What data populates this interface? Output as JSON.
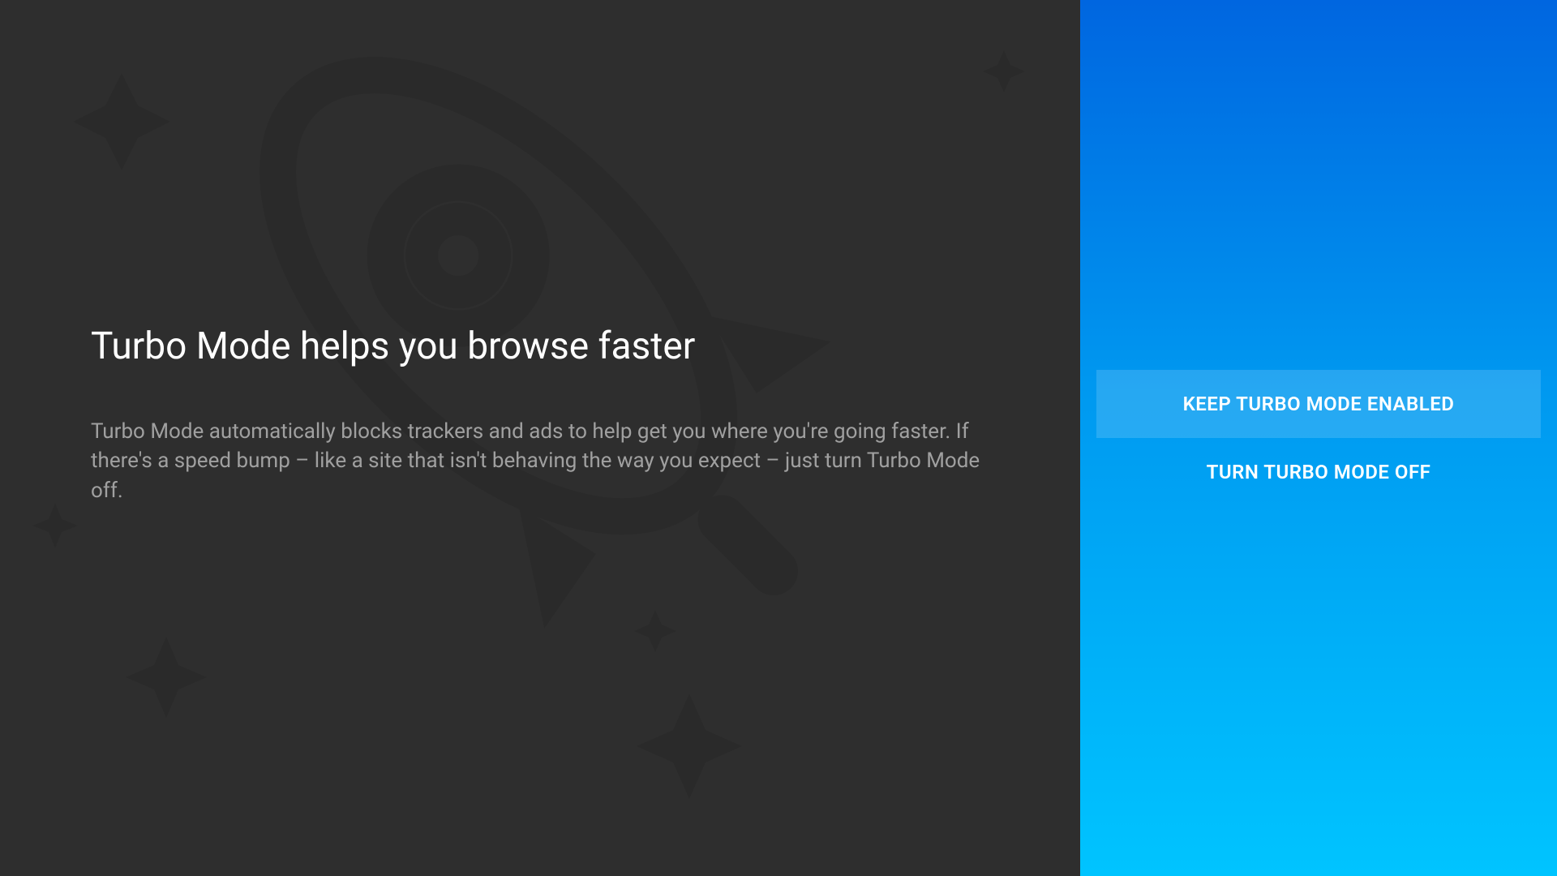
{
  "main": {
    "title": "Turbo Mode helps you browse faster",
    "description": "Turbo Mode automatically blocks trackers and ads to help get you where you're going faster. If there's a speed bump – like a site that isn't behaving the way you expect – just turn Turbo Mode off."
  },
  "actions": {
    "keep_enabled": "KEEP TURBO MODE ENABLED",
    "turn_off": "TURN TURBO MODE OFF"
  }
}
